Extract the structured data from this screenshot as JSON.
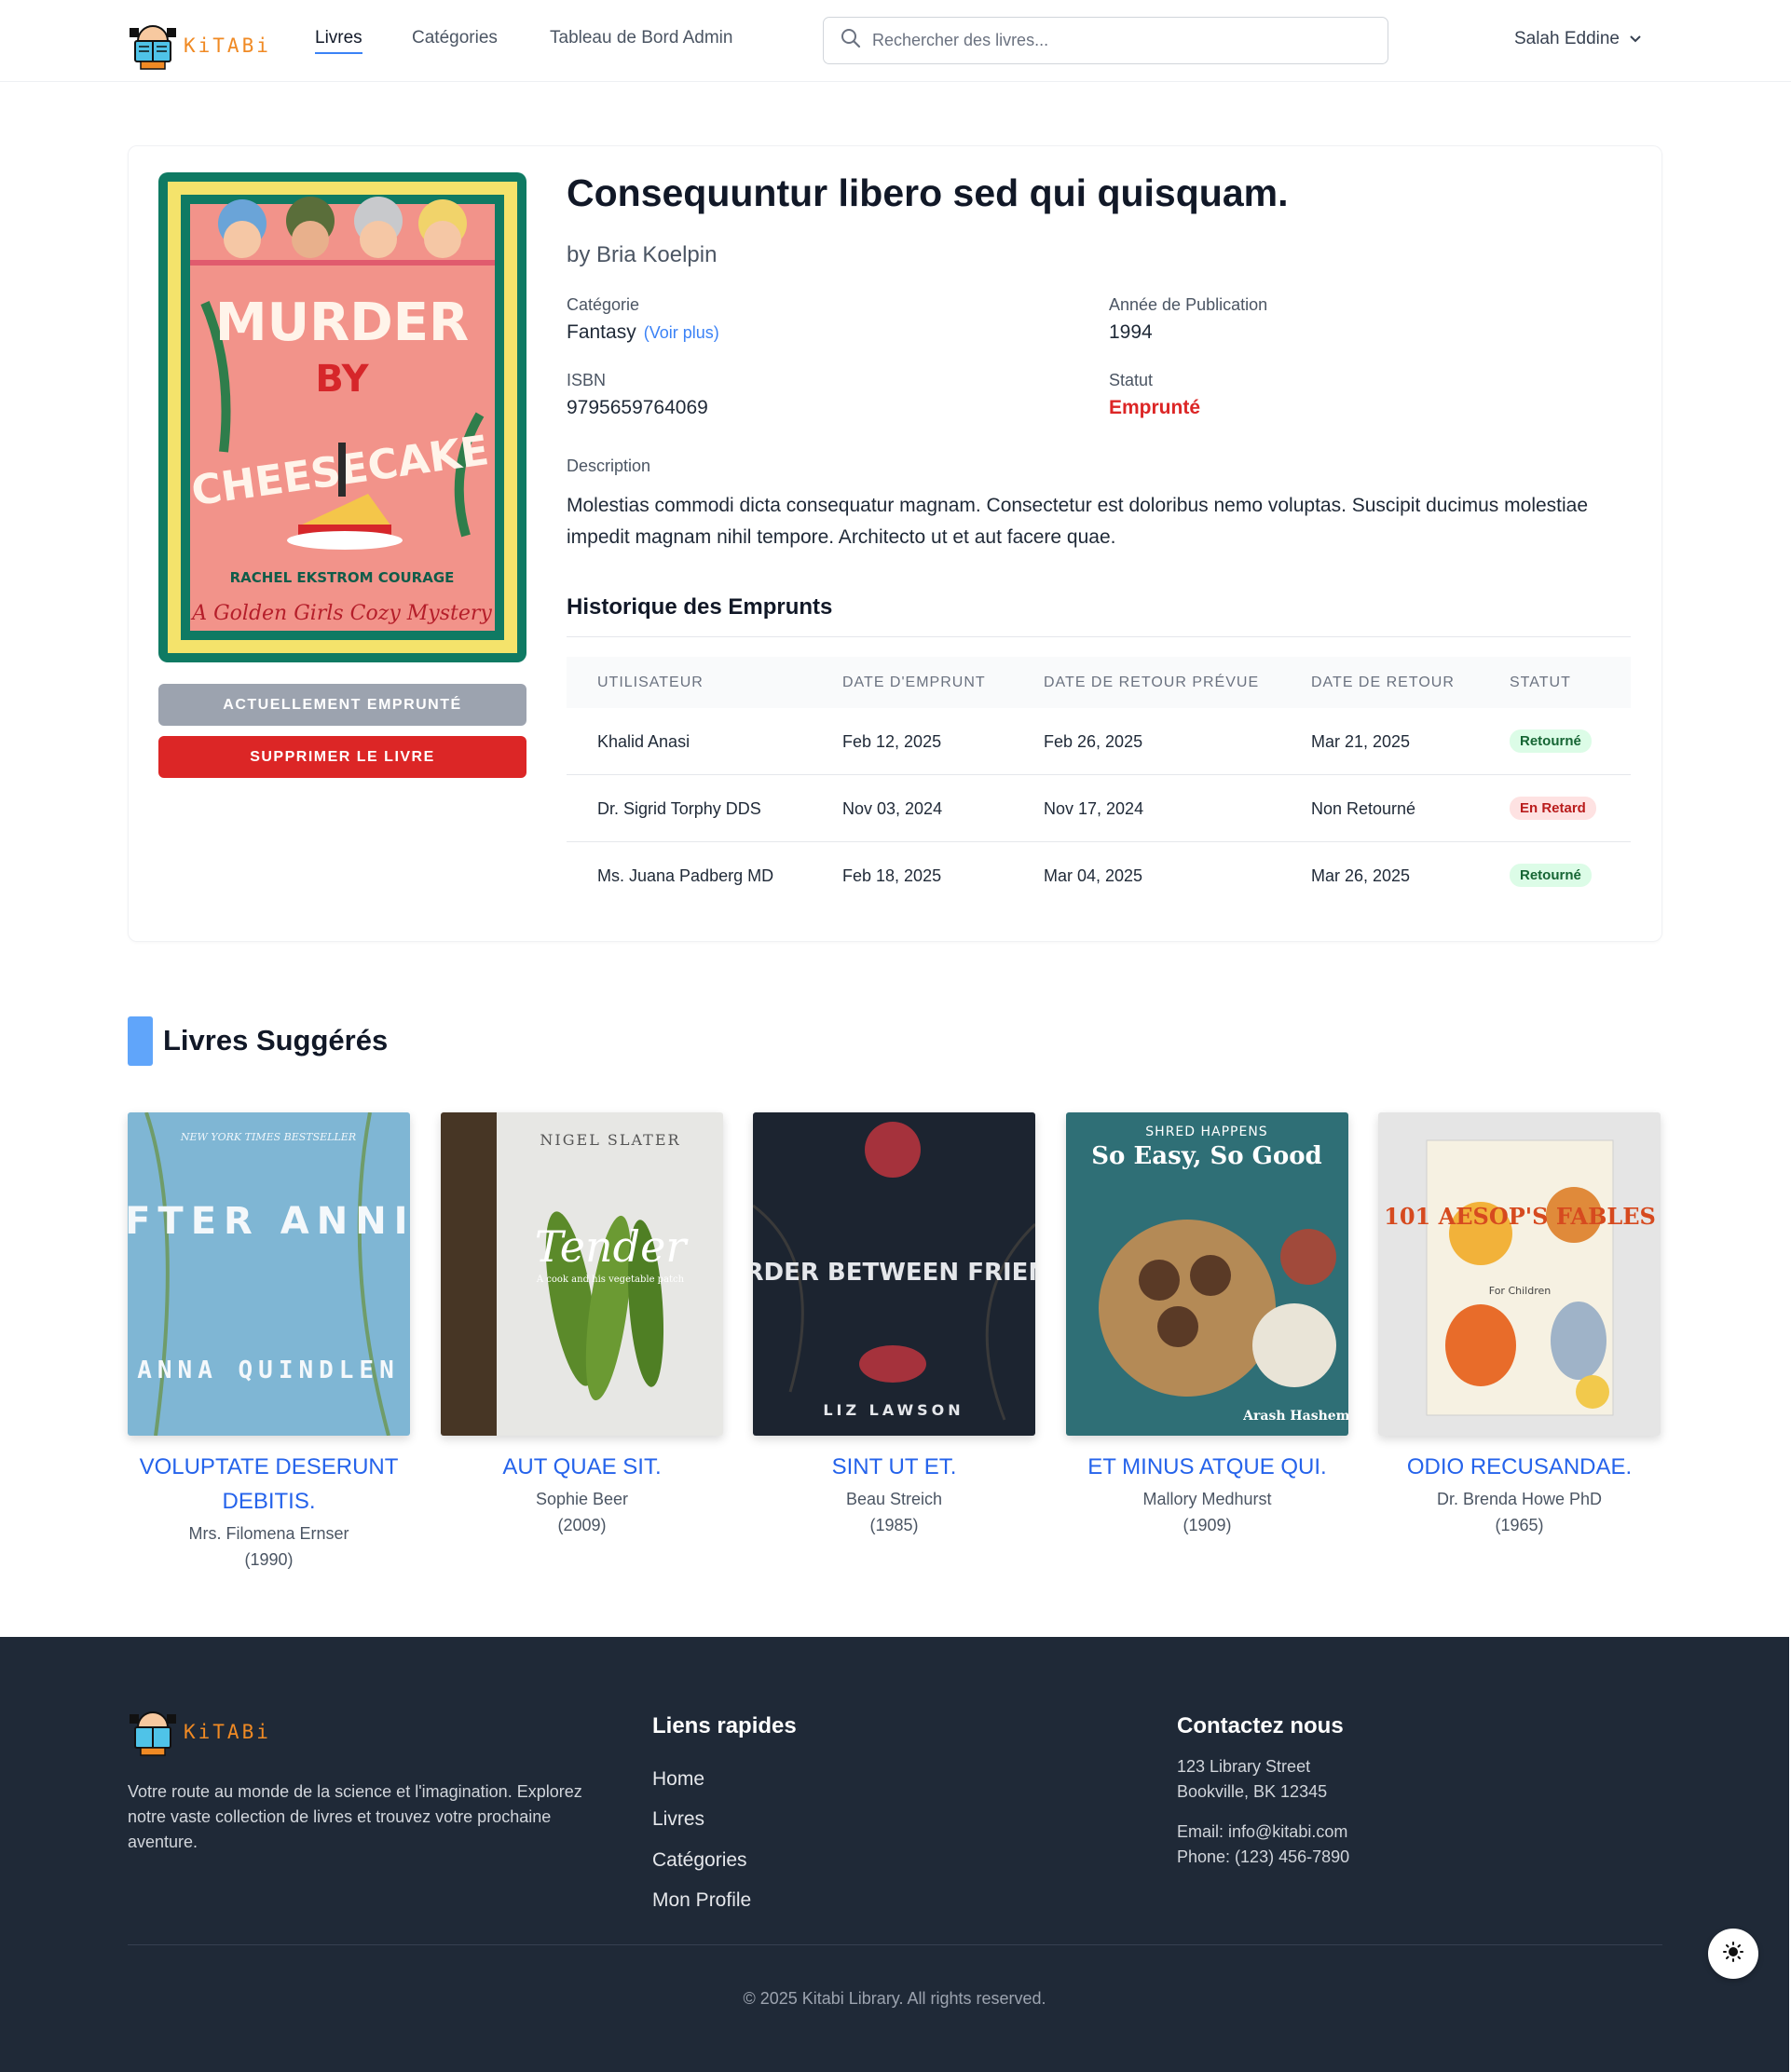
{
  "nav": {
    "logo_text": "KiTABi",
    "links": [
      {
        "label": "Livres",
        "active": true
      },
      {
        "label": "Catégories",
        "active": false
      },
      {
        "label": "Tableau de Bord Admin",
        "active": false
      }
    ],
    "search_placeholder": "Rechercher des livres...",
    "user_name": "Salah Eddine"
  },
  "book": {
    "cover": {
      "top_label": "MURDER",
      "mid_label": "BY",
      "main_label": "CHEESECAKE",
      "author_line": "RACHEL EKSTROM COURAGE",
      "tagline": "A Golden Girls Cozy Mystery"
    },
    "title": "Consequuntur libero sed qui quisquam.",
    "author": "by Bria Koelpin",
    "category_label": "Catégorie",
    "category_value": "Fantasy",
    "category_more": "(Voir plus)",
    "year_label": "Année de Publication",
    "year_value": "1994",
    "isbn_label": "ISBN",
    "isbn_value": "9795659764069",
    "status_label": "Statut",
    "status_value": "Emprunté",
    "description_label": "Description",
    "description": "Molestias commodi dicta consequatur magnam. Consectetur est doloribus nemo voluptas. Suscipit ducimus molestiae impedit magnam nihil tempore. Architecto ut et aut facere quae.",
    "btn_borrowed": "ACTUELLEMENT EMPRUNTÉ",
    "btn_delete": "SUPPRIMER LE LIVRE"
  },
  "history": {
    "title": "Historique des Emprunts",
    "columns": [
      "UTILISATEUR",
      "DATE D'EMPRUNT",
      "DATE DE RETOUR PRÉVUE",
      "DATE DE RETOUR",
      "STATUT"
    ],
    "rows": [
      {
        "user": "Khalid Anasi",
        "borrow": "Feb 12, 2025",
        "due": "Feb 26, 2025",
        "returned": "Mar 21, 2025",
        "status": "Retourné",
        "status_type": "ok"
      },
      {
        "user": "Dr. Sigrid Torphy DDS",
        "borrow": "Nov 03, 2024",
        "due": "Nov 17, 2024",
        "returned": "Non Retourné",
        "status": "En Retard",
        "status_type": "late"
      },
      {
        "user": "Ms. Juana Padberg MD",
        "borrow": "Feb 18, 2025",
        "due": "Mar 04, 2025",
        "returned": "Mar 26, 2025",
        "status": "Retourné",
        "status_type": "ok"
      }
    ]
  },
  "suggested": {
    "title": "Livres Suggérés",
    "books": [
      {
        "title": "Voluptate deserunt debitis.",
        "author": "Mrs. Filomena Ernser",
        "year": "(1990)",
        "cover_top": "NEW YORK TIMES BESTSELLER",
        "cover_title": "AFTER ANNIE",
        "cover_author": "ANNA QUINDLEN"
      },
      {
        "title": "Aut quae sit.",
        "author": "Sophie Beer",
        "year": "(2009)",
        "cover_top": "NIGEL SLATER",
        "cover_title": "Tender",
        "cover_author": "A cook and his vegetable patch"
      },
      {
        "title": "Sint ut et.",
        "author": "Beau Streich",
        "year": "(1985)",
        "cover_top": "",
        "cover_title": "MURDER BETWEEN FRIENDS",
        "cover_author": "LIZ LAWSON"
      },
      {
        "title": "Et minus atque qui.",
        "author": "Mallory Medhurst",
        "year": "(1909)",
        "cover_top": "SHRED HAPPENS",
        "cover_title": "So Easy, So Good",
        "cover_author": "Arash Hashemi"
      },
      {
        "title": "Odio recusandae.",
        "author": "Dr. Brenda Howe PhD",
        "year": "(1965)",
        "cover_top": "",
        "cover_title": "101 AESOP'S FABLES",
        "cover_author": "For Children"
      }
    ]
  },
  "footer": {
    "logo_text": "KiTABi",
    "description": "Votre route au monde de la science et l'imagination. Explorez notre vaste collection de livres et trouvez votre prochaine aventure.",
    "links_title": "Liens rapides",
    "links": [
      "Home",
      "Livres",
      "Catégories",
      "Mon Profile"
    ],
    "contact_title": "Contactez nous",
    "address_line1": "123 Library Street",
    "address_line2": "Bookville, BK 12345",
    "email": "Email: info@kitabi.com",
    "phone": "Phone: (123) 456-7890",
    "copyright": "© 2025 Kitabi Library. All rights reserved."
  },
  "colors": {
    "accent": "#3b82f6",
    "danger": "#dc2626",
    "footer_bg": "#1f2937",
    "logo": "#f08a24"
  }
}
